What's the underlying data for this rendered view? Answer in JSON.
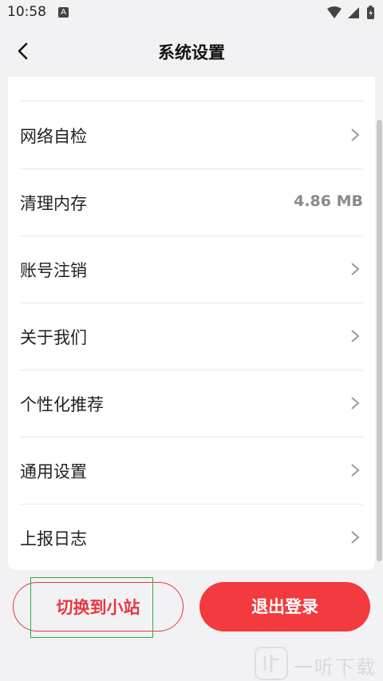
{
  "status_bar": {
    "time": "10:58",
    "notification_badge": "A"
  },
  "header": {
    "title": "系统设置",
    "back_icon": "chevron-left-icon"
  },
  "settings": [
    {
      "label": "网络自检",
      "type": "link"
    },
    {
      "label": "清理内存",
      "type": "value",
      "value": "4.86 MB"
    },
    {
      "label": "账号注销",
      "type": "link"
    },
    {
      "label": "关于我们",
      "type": "link"
    },
    {
      "label": "个性化推荐",
      "type": "link"
    },
    {
      "label": "通用设置",
      "type": "link"
    },
    {
      "label": "上报日志",
      "type": "link"
    }
  ],
  "buttons": {
    "switch_label": "切换到小站",
    "logout_label": "退出登录"
  },
  "watermark": {
    "text": "一听下载"
  },
  "colors": {
    "accent": "#f23a3f",
    "background": "#f2f2f4",
    "chevron": "#9a9a9a",
    "focus": "#27b43a"
  }
}
